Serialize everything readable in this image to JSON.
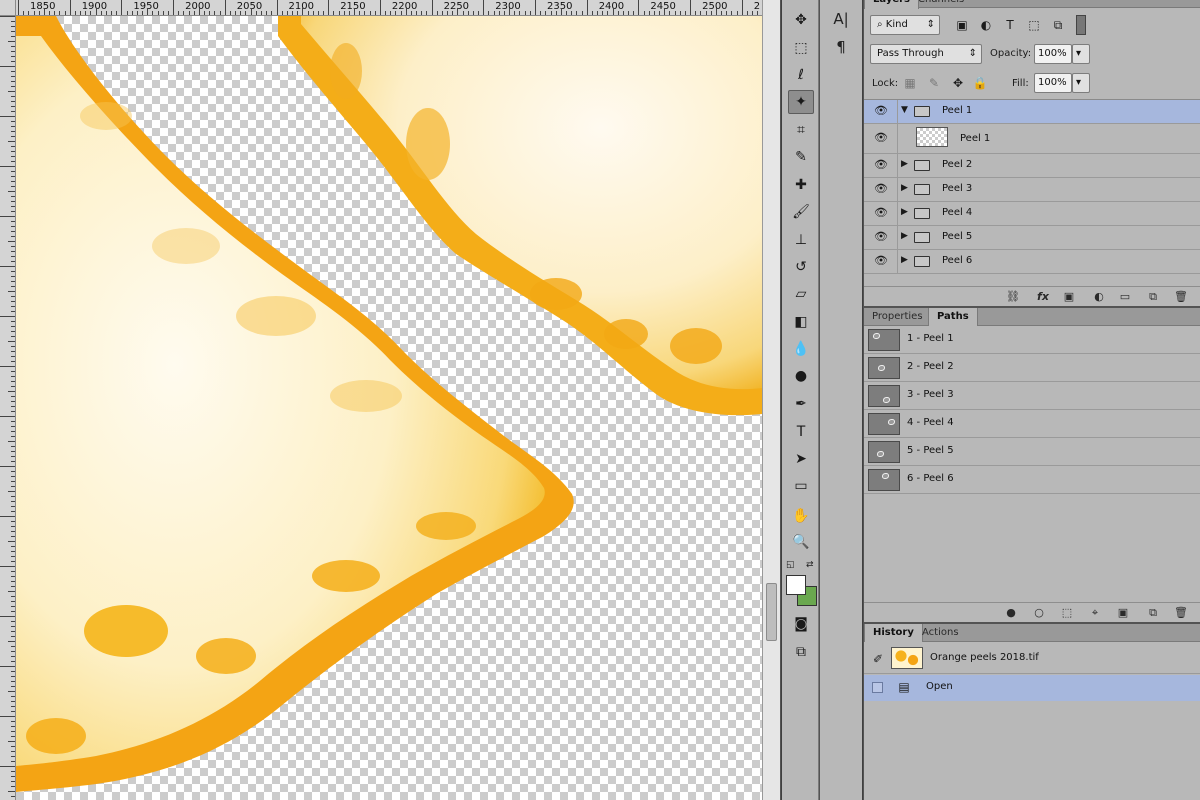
{
  "ruler": {
    "top_labels": [
      "1850",
      "1900",
      "1950",
      "2000",
      "2050",
      "2100",
      "2150",
      "2200",
      "2250",
      "2300",
      "2350",
      "2400",
      "2450",
      "2500",
      "2"
    ]
  },
  "tools": {
    "items": [
      {
        "name": "move-tool",
        "glyph": "✥"
      },
      {
        "name": "marquee-tool",
        "glyph": "⬚"
      },
      {
        "name": "lasso-tool",
        "glyph": "ℓ"
      },
      {
        "name": "magic-wand-tool",
        "glyph": "✦"
      },
      {
        "name": "crop-tool",
        "glyph": "⌗"
      },
      {
        "name": "eyedropper-tool",
        "glyph": "✎"
      },
      {
        "name": "healing-brush-tool",
        "glyph": "✚"
      },
      {
        "name": "brush-tool",
        "glyph": "🖌"
      },
      {
        "name": "clone-stamp-tool",
        "glyph": "⊥"
      },
      {
        "name": "history-brush-tool",
        "glyph": "↺"
      },
      {
        "name": "eraser-tool",
        "glyph": "▱"
      },
      {
        "name": "gradient-tool",
        "glyph": "◧"
      },
      {
        "name": "blur-tool",
        "glyph": "💧"
      },
      {
        "name": "dodge-tool",
        "glyph": "●"
      },
      {
        "name": "pen-tool",
        "glyph": "✒"
      },
      {
        "name": "type-tool",
        "glyph": "T"
      },
      {
        "name": "path-selection-tool",
        "glyph": "➤"
      },
      {
        "name": "rectangle-tool",
        "glyph": "▭"
      },
      {
        "name": "hand-tool",
        "glyph": "✋"
      },
      {
        "name": "zoom-tool",
        "glyph": "🔍"
      }
    ],
    "active": "magic-wand-tool",
    "foreground_color": "#ffffff",
    "background_color": "#6aa84f"
  },
  "layers_panel": {
    "tabs": [
      "Layers",
      "Channels"
    ],
    "filter_kind": "Kind",
    "blend_mode": "Pass Through",
    "opacity_label": "Opacity:",
    "opacity_value": "100%",
    "lock_label": "Lock:",
    "fill_label": "Fill:",
    "fill_value": "100%",
    "layers": [
      {
        "name": "Peel 1",
        "type": "group",
        "expanded": true,
        "selected": true
      },
      {
        "name": "Peel 1",
        "type": "pixel",
        "child": true
      },
      {
        "name": "Peel 2",
        "type": "group"
      },
      {
        "name": "Peel 3",
        "type": "group"
      },
      {
        "name": "Peel 4",
        "type": "group"
      },
      {
        "name": "Peel 5",
        "type": "group"
      },
      {
        "name": "Peel 6",
        "type": "group"
      }
    ]
  },
  "paths_panel": {
    "tabs": [
      "Properties",
      "Paths"
    ],
    "paths": [
      "1 - Peel 1",
      "2 - Peel 2",
      "3 - Peel 3",
      "4 - Peel 4",
      "5 - Peel 5",
      "6 - Peel 6"
    ]
  },
  "history_panel": {
    "tabs": [
      "History",
      "Actions"
    ],
    "snapshot": "Orange peels 2018.tif",
    "steps": [
      "Open"
    ]
  }
}
